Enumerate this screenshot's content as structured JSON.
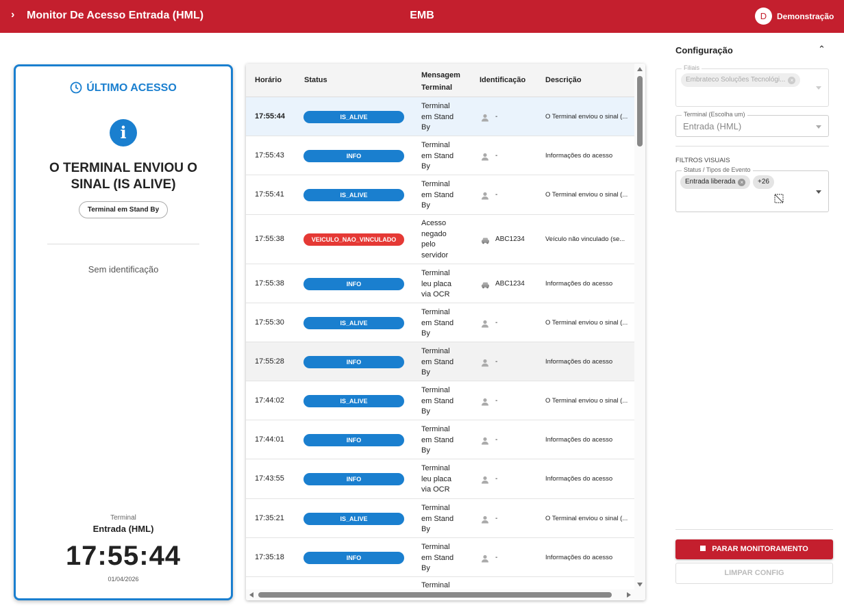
{
  "header": {
    "title": "Monitor De Acesso Entrada (HML)",
    "center_label": "EMB",
    "avatar_letter": "D",
    "user_name": "Demonstração",
    "bar_color": "#c41f2e"
  },
  "last_access": {
    "heading": "ÚLTIMO ACESSO",
    "message": "O TERMINAL ENVIOU O SINAL (IS ALIVE)",
    "chip": "Terminal em Stand By",
    "identification": "Sem identificação",
    "terminal_label": "Terminal",
    "terminal_name": "Entrada (HML)",
    "time": "17:55:44",
    "date": "01/04/2026",
    "accent_color": "#1a7fcf"
  },
  "table": {
    "columns": [
      "Horário",
      "Status",
      "Mensagem Terminal",
      "Identificação",
      "Descrição"
    ],
    "rows": [
      {
        "time": "17:55:44",
        "status": "IS_ALIVE",
        "status_color": "#1a7fcf",
        "message": [
          "Terminal",
          "em Stand",
          "By"
        ],
        "id_icon": "person-icon",
        "id": "-",
        "description": "O Terminal enviou o sinal (..."
      },
      {
        "time": "17:55:43",
        "status": "INFO",
        "status_color": "#1a7fcf",
        "message": [
          "Terminal",
          "em Stand",
          "By"
        ],
        "id_icon": "person-icon",
        "id": "-",
        "description": "Informações do acesso"
      },
      {
        "time": "17:55:41",
        "status": "IS_ALIVE",
        "status_color": "#1a7fcf",
        "message": [
          "Terminal",
          "em Stand",
          "By"
        ],
        "id_icon": "person-icon",
        "id": "-",
        "description": "O Terminal enviou o sinal (..."
      },
      {
        "time": "17:55:38",
        "status": "VEICULO_NAO_VINCULADO",
        "status_color": "#e53935",
        "message": [
          "Acesso",
          "negado",
          "pelo",
          "servidor"
        ],
        "id_icon": "car-icon",
        "id": "ABC1234",
        "description": "Veículo não vinculado (se..."
      },
      {
        "time": "17:55:38",
        "status": "INFO",
        "status_color": "#1a7fcf",
        "message": [
          "Terminal",
          "leu placa",
          "via OCR"
        ],
        "id_icon": "car-icon",
        "id": "ABC1234",
        "description": "Informações do acesso"
      },
      {
        "time": "17:55:30",
        "status": "IS_ALIVE",
        "status_color": "#1a7fcf",
        "message": [
          "Terminal",
          "em Stand",
          "By"
        ],
        "id_icon": "person-icon",
        "id": "-",
        "description": "O Terminal enviou o sinal (..."
      },
      {
        "time": "17:55:28",
        "status": "INFO",
        "status_color": "#1a7fcf",
        "message": [
          "Terminal",
          "em Stand",
          "By"
        ],
        "id_icon": "person-icon",
        "id": "-",
        "description": "Informações do acesso"
      },
      {
        "time": "17:44:02",
        "status": "IS_ALIVE",
        "status_color": "#1a7fcf",
        "message": [
          "Terminal",
          "em Stand",
          "By"
        ],
        "id_icon": "person-icon",
        "id": "-",
        "description": "O Terminal enviou o sinal (..."
      },
      {
        "time": "17:44:01",
        "status": "INFO",
        "status_color": "#1a7fcf",
        "message": [
          "Terminal",
          "em Stand",
          "By"
        ],
        "id_icon": "person-icon",
        "id": "-",
        "description": "Informações do acesso"
      },
      {
        "time": "17:43:55",
        "status": "INFO",
        "status_color": "#1a7fcf",
        "message": [
          "Terminal",
          "leu placa",
          "via OCR"
        ],
        "id_icon": "person-icon",
        "id": "-",
        "description": "Informações do acesso"
      },
      {
        "time": "17:35:21",
        "status": "IS_ALIVE",
        "status_color": "#1a7fcf",
        "message": [
          "Terminal",
          "em Stand",
          "By"
        ],
        "id_icon": "person-icon",
        "id": "-",
        "description": "O Terminal enviou o sinal (..."
      },
      {
        "time": "17:35:18",
        "status": "INFO",
        "status_color": "#1a7fcf",
        "message": [
          "Terminal",
          "em Stand",
          "By"
        ],
        "id_icon": "person-icon",
        "id": "-",
        "description": "Informações do acesso"
      },
      {
        "time": "",
        "status": "",
        "status_color": "",
        "message": [
          "Terminal"
        ],
        "id_icon": "",
        "id": "",
        "description": ""
      }
    ]
  },
  "config": {
    "title": "Configuração",
    "filiais_label": "Filiais",
    "filiais_chip": "Embrateco Soluções Tecnológi...",
    "terminal_label": "Terminal (Escolha um)",
    "terminal_value": "Entrada (HML)",
    "visual_filters": "FILTROS VISUAIS",
    "status_label": "Status / Tipos de Evento",
    "status_chip": "Entrada liberada",
    "status_more": "+26",
    "stop_button": "PARAR MONITORAMENTO",
    "clear_button": "LIMPAR CONFIG"
  }
}
